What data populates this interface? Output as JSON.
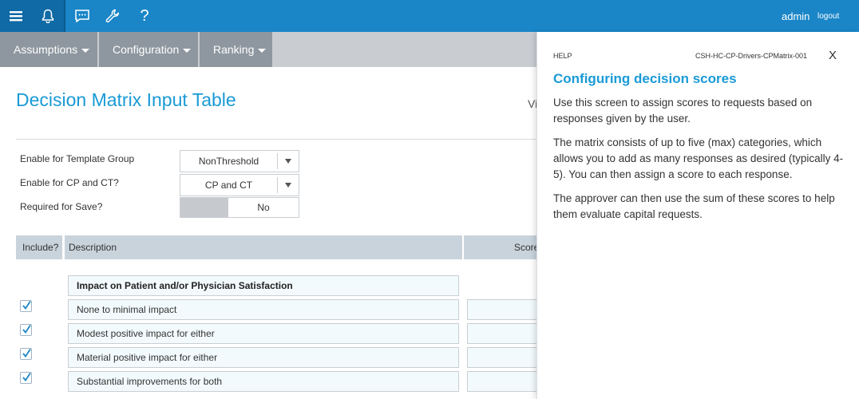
{
  "topbar": {
    "menu_icon": "hamburger-menu-icon",
    "bell_icon": "bell-icon",
    "chat_icon": "chat-icon",
    "wrench_icon": "wrench-icon",
    "help_label": "?",
    "user": "admin",
    "logout": "logout",
    "colors": {
      "bar": "#1a86c8",
      "active": "#0f6aa6"
    }
  },
  "nav": {
    "items": [
      {
        "label": "Assumptions"
      },
      {
        "label": "Configuration"
      },
      {
        "label": "Ranking"
      }
    ],
    "colors": {
      "item": "#8e979f",
      "bar": "#c9cdd2"
    }
  },
  "page": {
    "title": "Decision Matrix Input Table",
    "cut_text": "Vi"
  },
  "form": {
    "template_group": {
      "label": "Enable for Template Group",
      "value": "NonThreshold"
    },
    "cp_ct": {
      "label": "Enable for CP and CT?",
      "value": "CP and CT"
    },
    "required": {
      "label": "Required for Save?",
      "value": "No"
    }
  },
  "table": {
    "headers": {
      "include": "Include?",
      "description": "Description",
      "score": "Score"
    },
    "category": "Impact on Patient and/or Physician Satisfaction",
    "rows": [
      {
        "description": "None to minimal impact",
        "included": true
      },
      {
        "description": "Modest positive impact for either",
        "included": true
      },
      {
        "description": "Material positive impact for either",
        "included": true
      },
      {
        "description": "Substantial improvements for both",
        "included": true
      }
    ]
  },
  "help": {
    "tag": "HELP",
    "code": "CSH-HC-CP-Drivers-CPMatrix-001",
    "close": "X",
    "title": "Configuring decision scores",
    "paragraphs": [
      "Use this screen to assign scores to requests based on responses given by the user.",
      "The matrix consists of up to five (max) categories, which allows you to add as many responses as desired (typically 4-5). You can then assign a score to each response.",
      "The approver can then use the sum of these scores to help them evaluate capital requests."
    ]
  },
  "accent_color": "#1a9ad6"
}
